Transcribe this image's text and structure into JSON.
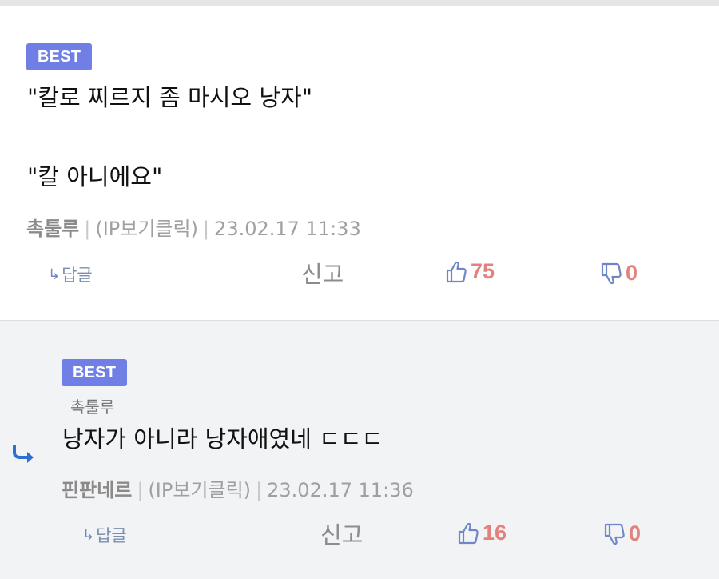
{
  "comments": [
    {
      "badge": "BEST",
      "lines": [
        "\"칼로 찌르지 좀 마시오 낭자\"",
        "\"칼 아니에요\""
      ],
      "author": "촉툴루",
      "ip": "(IP보기클릭)",
      "date": "23.02.17 11:33",
      "reply_label": "답글",
      "report_label": "신고",
      "likes": "75",
      "dislikes": "0"
    },
    {
      "badge": "BEST",
      "reply_to": "촉툴루",
      "lines": [
        "낭자가 아니라 낭자애였네 ㄷㄷㄷ"
      ],
      "author": "핀판네르",
      "ip": "(IP보기클릭)",
      "date": "23.02.17 11:36",
      "reply_label": "답글",
      "report_label": "신고",
      "likes": "16",
      "dislikes": "0"
    }
  ],
  "icons": {
    "reply_arrow": "reply-arrow-icon",
    "thumb_up": "thumbs-up-icon",
    "thumb_down": "thumbs-down-icon",
    "nested": "nested-reply-icon"
  },
  "colors": {
    "badge": "#6f7fe6",
    "vote_count": "#e3827c",
    "thumb_icon": "#6f86c7"
  }
}
